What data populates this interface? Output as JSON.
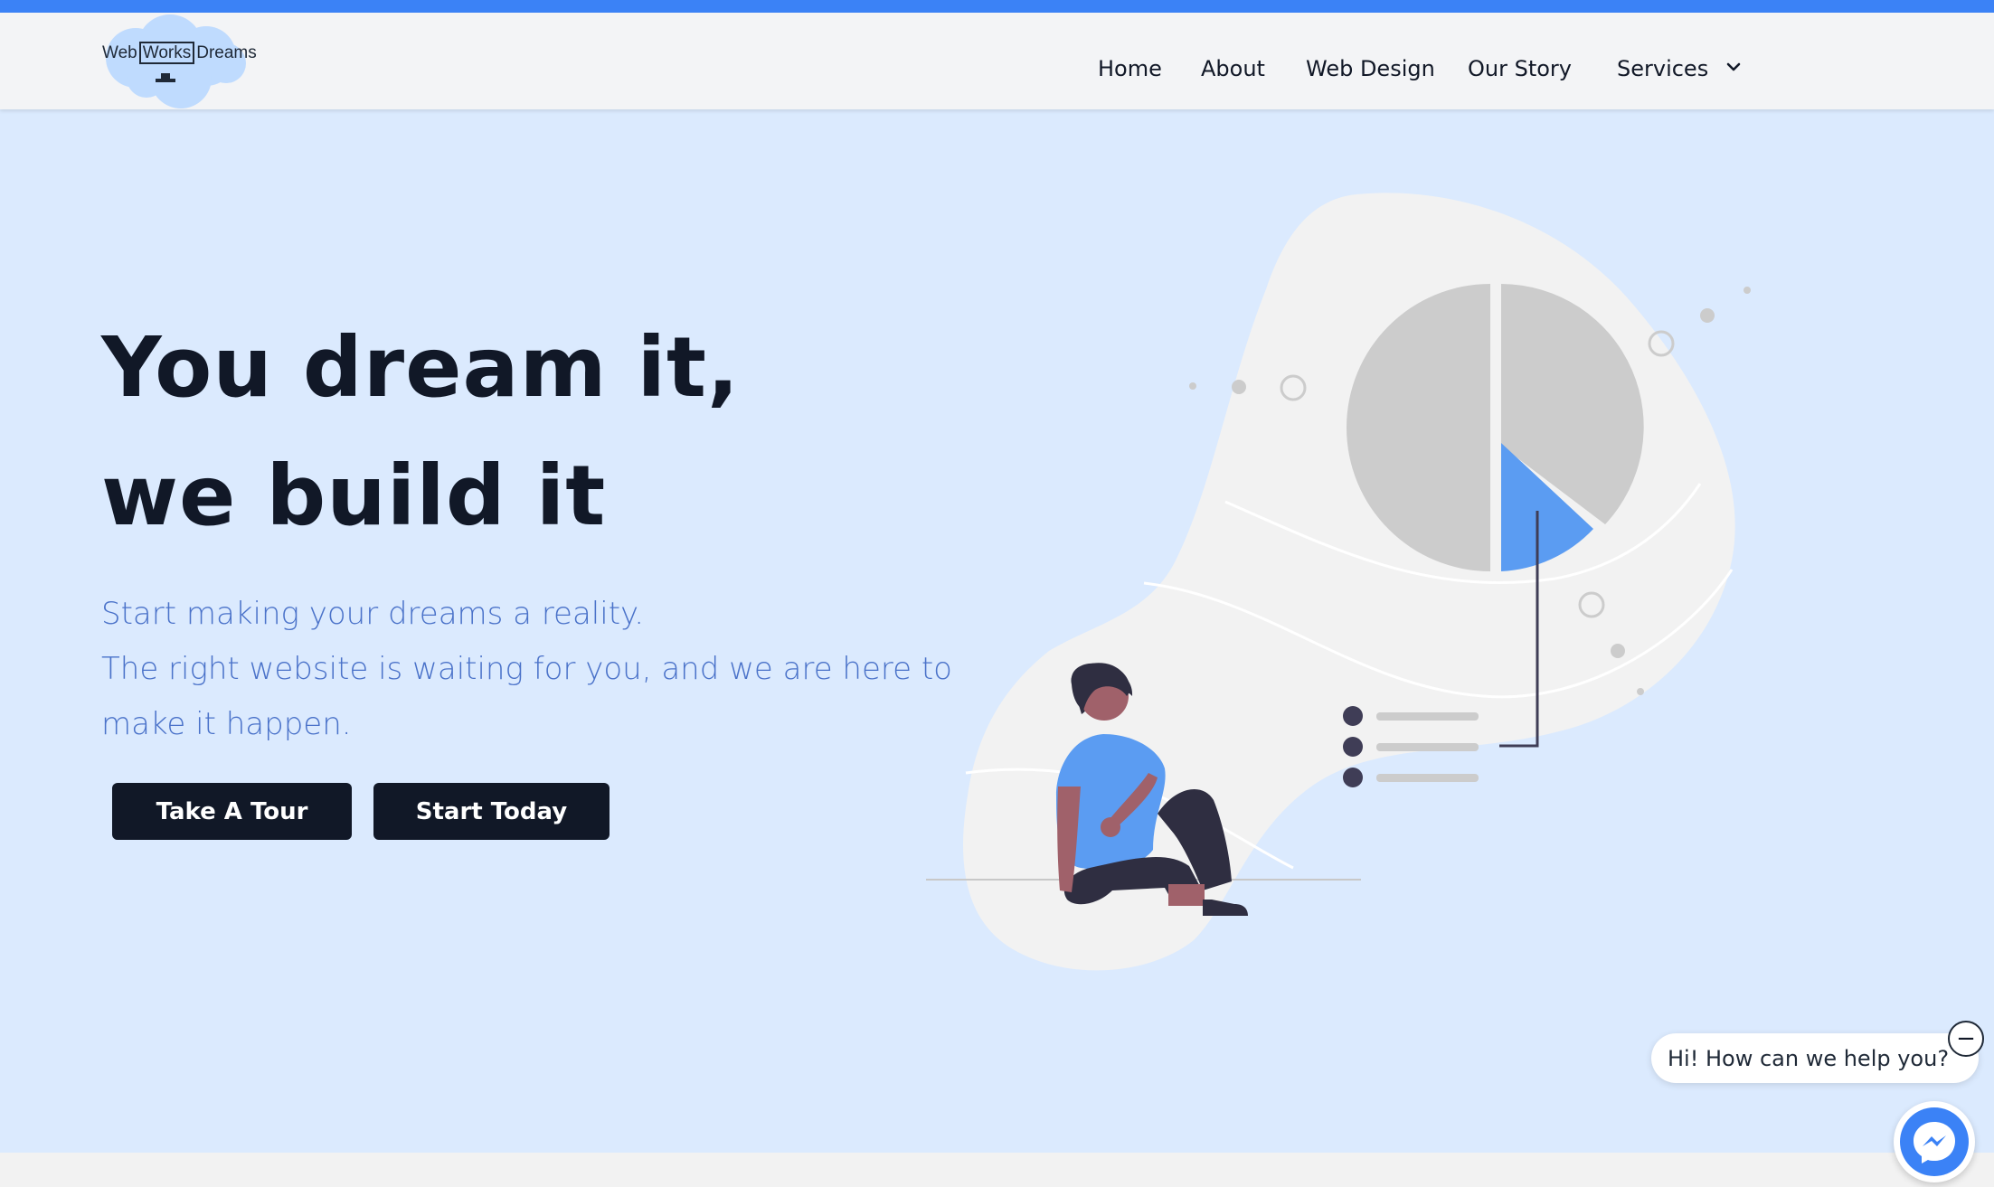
{
  "logo": {
    "text_before": "Web",
    "text_boxed": "Works",
    "text_after": "Dreams"
  },
  "nav": {
    "items": [
      {
        "label": "Home"
      },
      {
        "label": "About"
      },
      {
        "label": "Web Design"
      },
      {
        "label": "Our Story"
      },
      {
        "label": "Services",
        "icon": "chevron-down-icon"
      }
    ]
  },
  "hero": {
    "headline_line1": "You dream it,",
    "headline_line2": "we build it",
    "lead_line1": "Start making your dreams a reality.",
    "lead_line2": "The right website is waiting for you, and we are here to",
    "lead_line3": "make it happen.",
    "primary_button": "Take A Tour",
    "secondary_button": "Start Today"
  },
  "chat": {
    "bubble_text": "Hi! How can we help you?",
    "close_symbol": "−",
    "messenger_icon": "messenger-icon"
  },
  "colors": {
    "accent_bar": "#3b82f6",
    "hero_background": "#dbeafe",
    "headline": "#111827",
    "lead_text": "#4a72c9",
    "button_bg": "#111827",
    "illustration_blue": "#5b9cf2"
  }
}
